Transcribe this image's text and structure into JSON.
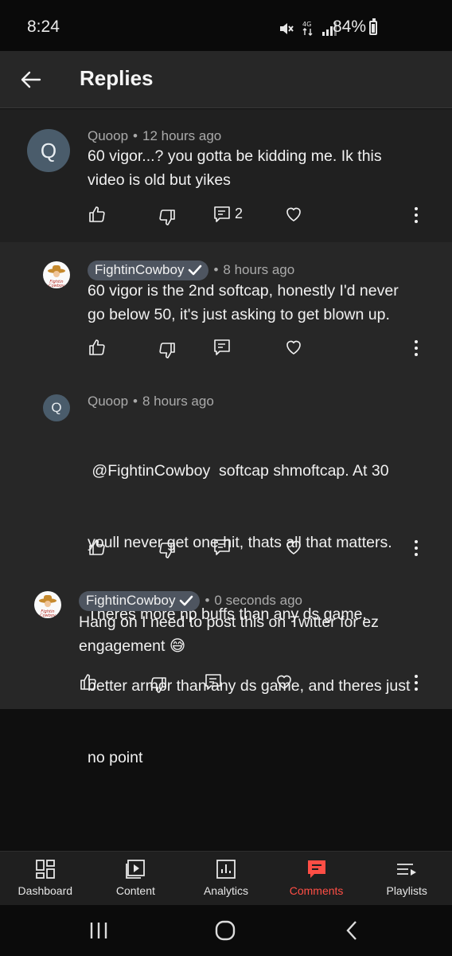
{
  "status_bar": {
    "time": "8:24",
    "battery": "84%"
  },
  "header": {
    "title": "Replies"
  },
  "comments": [
    {
      "author": "Quoop",
      "avatar_letter": "Q",
      "time": "12 hours ago",
      "lines": [
        "60 vigor...? you gotta be kidding me. Ik this",
        "video is old but yikes"
      ],
      "reply_count": "2"
    },
    {
      "author": "FightinCowboy",
      "time": "8 hours ago",
      "lines": [
        "60 vigor is the 2nd softcap, honestly I'd never",
        "go below 50, it's just asking to get blown up."
      ]
    },
    {
      "author": "Quoop",
      "avatar_letter": "Q",
      "time": "8 hours ago",
      "lines": [
        " @FightinCowboy  softcap shmoftcap. At 30",
        "youll never get one hit, thats all that matters.",
        "Theres more hp buffs than any ds game,",
        "better armor than any ds game, and theres just",
        "no point"
      ]
    },
    {
      "author": "FightinCowboy",
      "time": "0 seconds ago",
      "lines": [
        "Hang on I need to post this on Twitter for ez",
        "engagement 😅"
      ]
    }
  ],
  "bottom_nav": [
    {
      "label": "Dashboard",
      "icon": "dashboard-icon"
    },
    {
      "label": "Content",
      "icon": "content-icon"
    },
    {
      "label": "Analytics",
      "icon": "analytics-icon"
    },
    {
      "label": "Comments",
      "icon": "comments-icon",
      "active": true
    },
    {
      "label": "Playlists",
      "icon": "playlists-icon"
    }
  ],
  "colors": {
    "accent": "#ff4e45",
    "background": "#0f0f0f",
    "panel": "#272727",
    "badge": "#4e5560"
  }
}
